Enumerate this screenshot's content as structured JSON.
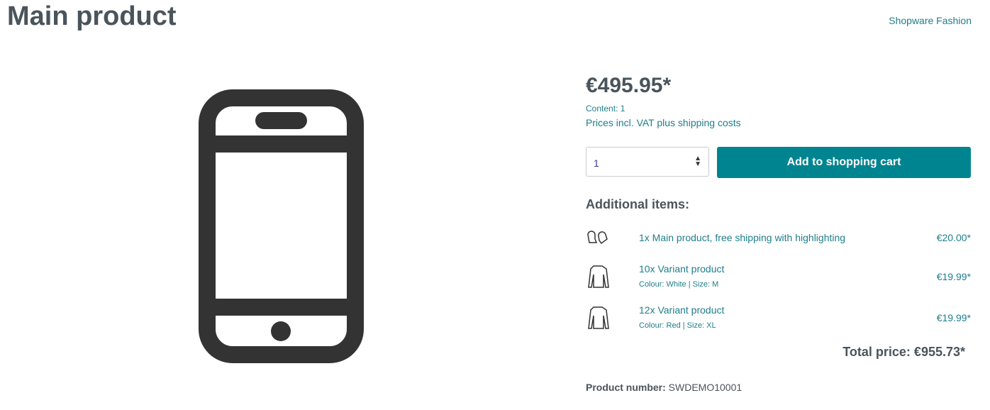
{
  "title": "Main product",
  "brand": "Shopware Fashion",
  "price": "€495.95*",
  "content": "Content: 1",
  "vat_note": "Prices incl. VAT plus shipping costs",
  "quantity": "1",
  "add_to_cart": "Add to shopping cart",
  "additional_heading": "Additional items:",
  "items": [
    {
      "icon": "mittens-icon",
      "name": "1x Main product, free shipping with highlighting",
      "price": "€20.00*"
    },
    {
      "icon": "sweater-icon",
      "name": "10x Variant product",
      "options": "Colour: White | Size: M",
      "price": "€19.99*"
    },
    {
      "icon": "sweater-icon",
      "name": "12x Variant product",
      "options": "Colour: Red | Size: XL",
      "price": "€19.99*"
    }
  ],
  "total": "Total price: €955.73*",
  "product_number_label": "Product number:",
  "product_number": "SWDEMO10001",
  "colors": {
    "accent": "#008490",
    "text": "#4a545b"
  }
}
